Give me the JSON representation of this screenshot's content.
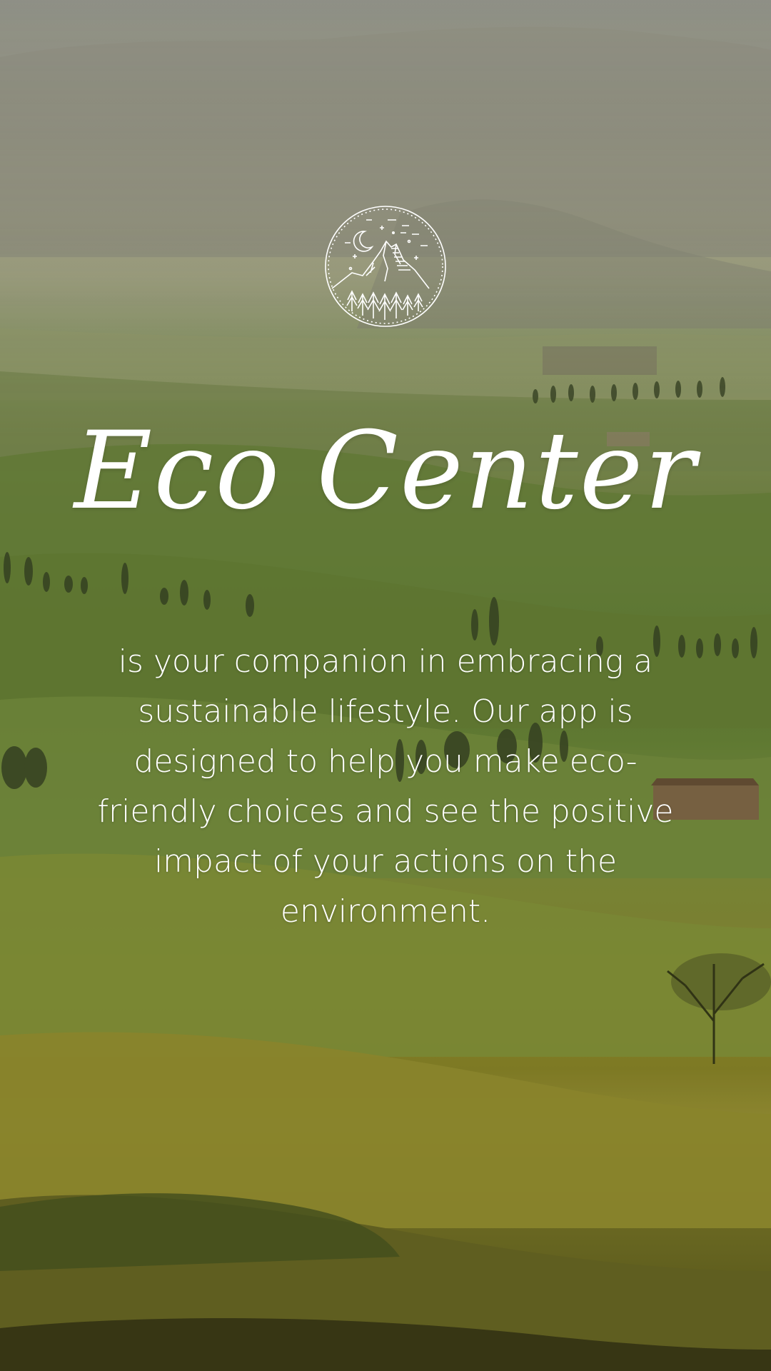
{
  "app": {
    "name": "Eco Center",
    "tagline": "is your companion in embracing a sustainable lifestyle. Our app is designed to help you make eco-friendly choices and see the positive impact of your actions on the environment."
  },
  "logo": {
    "icon": "mountain-night-sky-emblem-icon"
  },
  "colors": {
    "text": "#ffffff",
    "grass": "#7a9340",
    "haze": "#a7a68a"
  }
}
